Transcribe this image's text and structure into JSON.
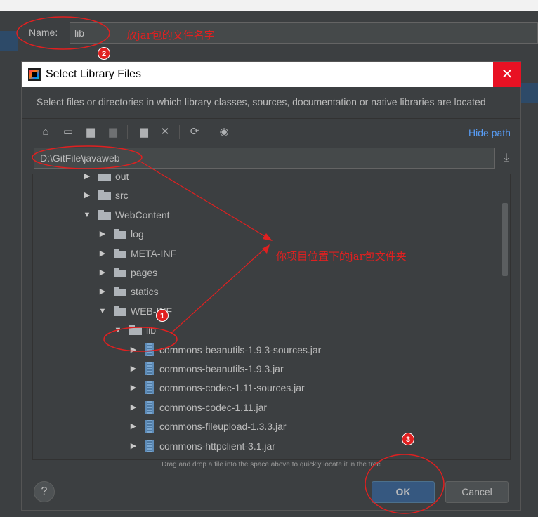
{
  "background": {
    "name_label": "Name:",
    "name_value": "lib"
  },
  "dialog": {
    "title": "Select Library Files",
    "close_glyph": "✕",
    "description": "Select files or directories in which library classes, sources, documentation or native libraries are located",
    "hide_path": "Hide path",
    "path_value": "D:\\GitFile\\javaweb",
    "hint": "Drag and drop a file into the space above to quickly locate it in the tree",
    "help_label": "?",
    "ok_label": "OK",
    "cancel_label": "Cancel"
  },
  "toolbar_icons": [
    "home-icon",
    "desktop-icon",
    "project-folder-icon",
    "module-folder-icon",
    "new-folder-icon",
    "delete-icon",
    "refresh-icon",
    "show-hidden-icon"
  ],
  "tree": [
    {
      "label": "out",
      "depth": 0,
      "expanded": false,
      "kind": "folder"
    },
    {
      "label": "src",
      "depth": 0,
      "expanded": false,
      "kind": "folder"
    },
    {
      "label": "WebContent",
      "depth": 0,
      "expanded": true,
      "kind": "folder"
    },
    {
      "label": "log",
      "depth": 1,
      "expanded": false,
      "kind": "folder"
    },
    {
      "label": "META-INF",
      "depth": 1,
      "expanded": false,
      "kind": "folder"
    },
    {
      "label": "pages",
      "depth": 1,
      "expanded": false,
      "kind": "folder"
    },
    {
      "label": "statics",
      "depth": 1,
      "expanded": false,
      "kind": "folder"
    },
    {
      "label": "WEB-INF",
      "depth": 1,
      "expanded": true,
      "kind": "folder"
    },
    {
      "label": "lib",
      "depth": 2,
      "expanded": true,
      "kind": "folder"
    },
    {
      "label": "commons-beanutils-1.9.3-sources.jar",
      "depth": 3,
      "expanded": false,
      "kind": "jar"
    },
    {
      "label": "commons-beanutils-1.9.3.jar",
      "depth": 3,
      "expanded": false,
      "kind": "jar"
    },
    {
      "label": "commons-codec-1.11-sources.jar",
      "depth": 3,
      "expanded": false,
      "kind": "jar"
    },
    {
      "label": "commons-codec-1.11.jar",
      "depth": 3,
      "expanded": false,
      "kind": "jar"
    },
    {
      "label": "commons-fileupload-1.3.3.jar",
      "depth": 3,
      "expanded": false,
      "kind": "jar"
    },
    {
      "label": "commons-httpclient-3.1.jar",
      "depth": 3,
      "expanded": false,
      "kind": "jar"
    }
  ],
  "annotations": {
    "note_name": "放jar包的文件名字",
    "note_folder": "你项目位置下的jar包文件夹",
    "badge_1": "1",
    "badge_2": "2",
    "badge_3": "3",
    "color": "#e02020"
  },
  "colors": {
    "dialog_bg": "#3c3f41",
    "link": "#589df6",
    "ok_button": "#365880",
    "close_button": "#e81123"
  }
}
